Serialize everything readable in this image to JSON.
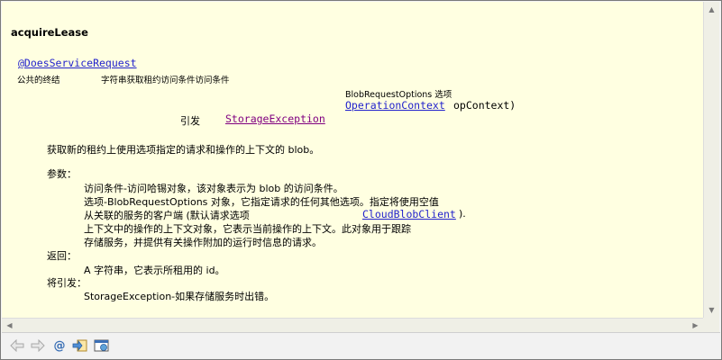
{
  "doc": {
    "title": "acquireLease",
    "annotation": "@DoesServiceRequest",
    "sig_modifiers": "公共的终结",
    "sig_desc": "字符串获取租约访问条件访问条件",
    "sig_param_type": "BlobRequestOptions 选项",
    "sig_opcontext_link": "OperationContext",
    "sig_opcontext_rest": "opContext)",
    "throws_label": "引发",
    "throws_link": "StorageException",
    "summary": "获取新的租约上使用选项指定的请求和操作的上下文的 blob。",
    "params_label": "参数：",
    "param_lines": [
      "访问条件-访问哈锡对象，该对象表示为 blob 的访问条件。",
      "选项-BlobRequestOptions 对象，它指定请求的任何其他选项。指定将使用空值",
      "从关联的服务的客户端 (默认请求选项"
    ],
    "client_link": "CloudBlobClient",
    "client_after": ").",
    "param_lines2": [
      "上下文中的操作的上下文对象，它表示当前操作的上下文。此对象用于跟踪",
      "存储服务，并提供有关操作附加的运行时信息的请求。"
    ],
    "returns_label": "返回：",
    "returns_text": "A 字符串，它表示所租用的 id。",
    "throws_section_label": "将引发：",
    "throws_text": "StorageException-如果存储服务时出错。"
  },
  "toolbar": {
    "back_icon": "back-arrow-icon",
    "forward_icon": "forward-arrow-icon",
    "at_symbol": "@",
    "open_declaration_icon": "open-declaration-icon",
    "open_external_icon": "open-external-browser-icon"
  },
  "colors": {
    "content_bg": "#ffffe1",
    "link": "#2222cc",
    "visited_link": "#800080"
  }
}
